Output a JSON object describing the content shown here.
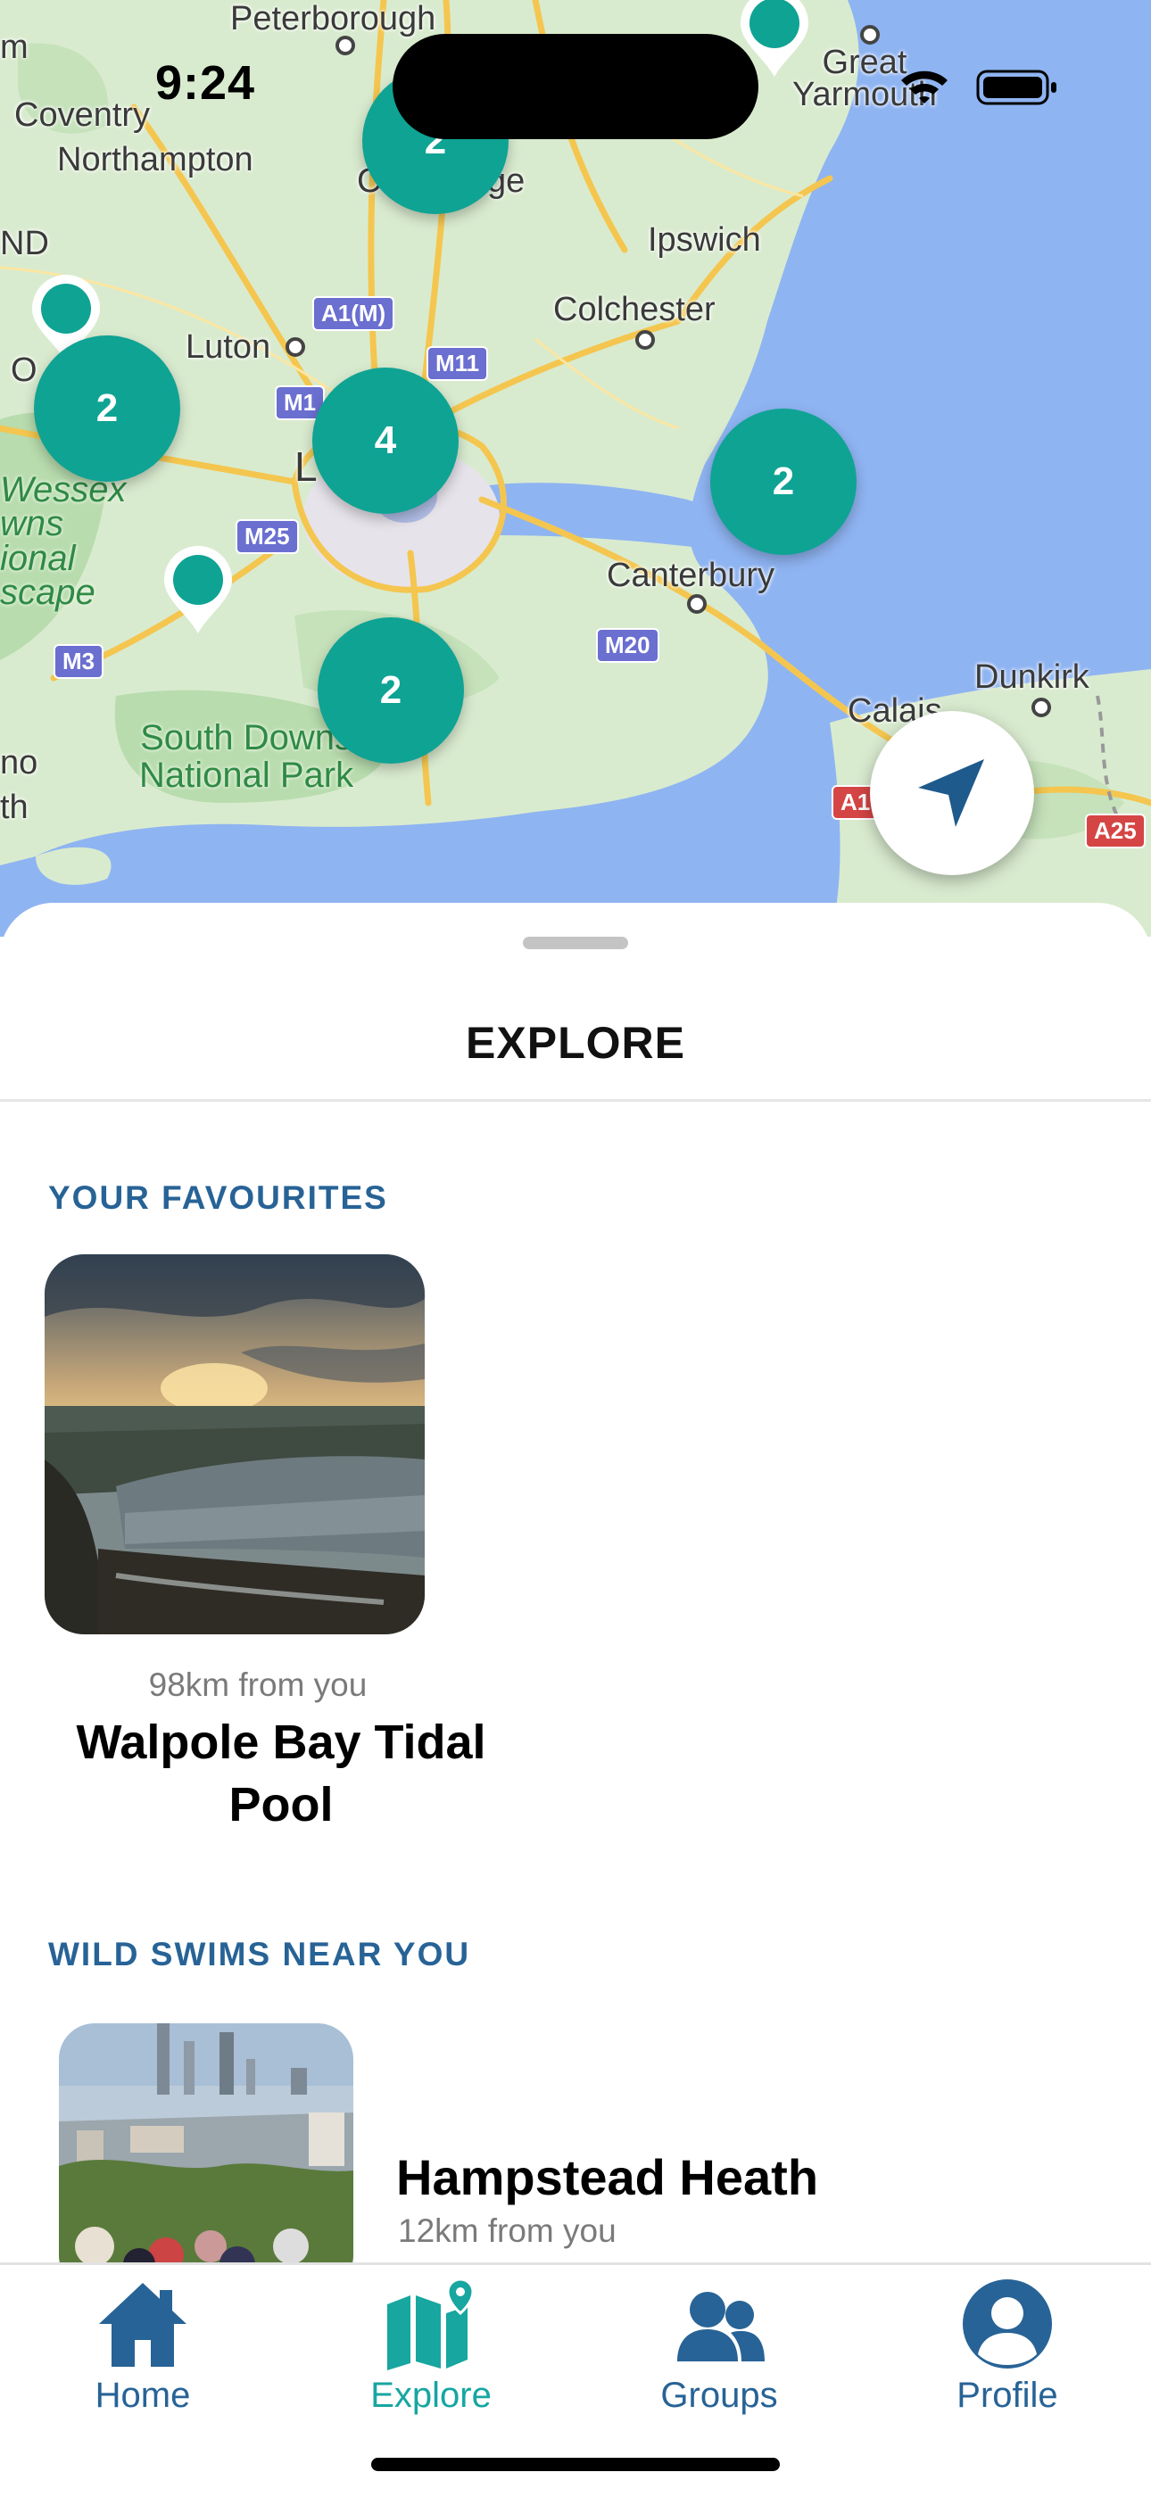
{
  "status_bar": {
    "time": "9:24"
  },
  "map": {
    "places": [
      {
        "id": "peterborough",
        "label": "Peterborough"
      },
      {
        "id": "coventry",
        "label": "Coventry"
      },
      {
        "id": "northampton",
        "label": "Northampton"
      },
      {
        "id": "cambridge_a",
        "label": "Ca"
      },
      {
        "id": "cambridge_b",
        "label": "ge"
      },
      {
        "id": "ipswich",
        "label": "Ipswich"
      },
      {
        "id": "colchester",
        "label": "Colchester"
      },
      {
        "id": "luton",
        "label": "Luton"
      },
      {
        "id": "great_yarmouth",
        "label": "Great\nYarmouth"
      },
      {
        "id": "canterbury",
        "label": "Canterbury"
      },
      {
        "id": "dunkirk",
        "label": "Dunkirk"
      },
      {
        "id": "calais",
        "label": "Calais"
      },
      {
        "id": "london_l",
        "label": "L"
      },
      {
        "id": "nd",
        "label": "ND"
      },
      {
        "id": "m_frag",
        "label": "m"
      },
      {
        "id": "ox_frag",
        "label": "O"
      },
      {
        "id": "no_frag",
        "label": "no"
      },
      {
        "id": "th_frag",
        "label": "th"
      }
    ],
    "parks": {
      "south_downs": "South Downs\nNational Park",
      "wessex": "Wessex\nwns\nional\nscape"
    },
    "roads": [
      "A1(M)",
      "M11",
      "M1",
      "M25",
      "M3",
      "M20",
      "A1",
      "A25"
    ],
    "clusters": [
      {
        "id": "cluster-cambridge",
        "count": "2"
      },
      {
        "id": "cluster-oxford",
        "count": "2"
      },
      {
        "id": "cluster-london",
        "count": "4"
      },
      {
        "id": "cluster-essex",
        "count": "2"
      },
      {
        "id": "cluster-sussex",
        "count": "2"
      }
    ],
    "colors": {
      "water": "#8fb4f2",
      "land": "#d9ebcf",
      "park": "#b8dcae",
      "marker": "#0fa394",
      "road": "#f4c64f"
    }
  },
  "sheet": {
    "title": "EXPLORE",
    "favourites": {
      "heading": "YOUR FAVOURITES",
      "items": [
        {
          "distance": "98km from you",
          "name": "Walpole Bay Tidal Pool"
        }
      ]
    },
    "nearby": {
      "heading": "WILD SWIMS NEAR YOU",
      "items": [
        {
          "name": "Hampstead Heath",
          "distance": "12km from you"
        }
      ]
    }
  },
  "tabbar": {
    "active": "explore",
    "tabs": [
      {
        "id": "home",
        "label": "Home",
        "icon": "home-icon"
      },
      {
        "id": "explore",
        "label": "Explore",
        "icon": "map-icon"
      },
      {
        "id": "groups",
        "label": "Groups",
        "icon": "groups-icon"
      },
      {
        "id": "profile",
        "label": "Profile",
        "icon": "profile-icon"
      }
    ],
    "colors": {
      "active": "#17a6a0",
      "inactive": "#276396"
    }
  }
}
